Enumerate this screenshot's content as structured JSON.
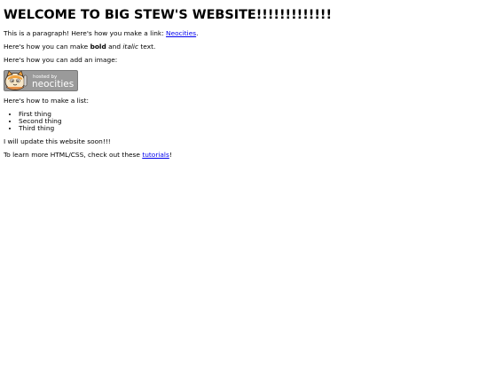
{
  "page": {
    "heading": "WELCOME TO BIG STEW'S WEBSITE!!!!!!!!!!!!!",
    "link_intro": "This is a paragraph! Here's how you make a link: ",
    "link_text": "Neocities",
    "link_end": ".",
    "format_intro": "Here's how you can make ",
    "bold_text": "bold",
    "format_and": " and ",
    "italic_text": "italic",
    "format_end": " text.",
    "image_intro": "Here's how you can add an image:",
    "badge": {
      "small_text": "hosted by",
      "big_text": "neocities",
      "bg_color": "#9a9a9a",
      "icon": "cat-mascot-icon"
    },
    "list_intro": "Here's how to make a list:",
    "list_items": [
      "First thing",
      "Second thing",
      "Third thing"
    ],
    "update_text": "I will update this website soon!!!",
    "learn_intro": "To learn more HTML/CSS, check out these ",
    "tutorials_link": "tutorials",
    "learn_end": "!"
  },
  "colors": {
    "link": "#0000ee",
    "text": "#000000",
    "background": "#ffffff"
  }
}
